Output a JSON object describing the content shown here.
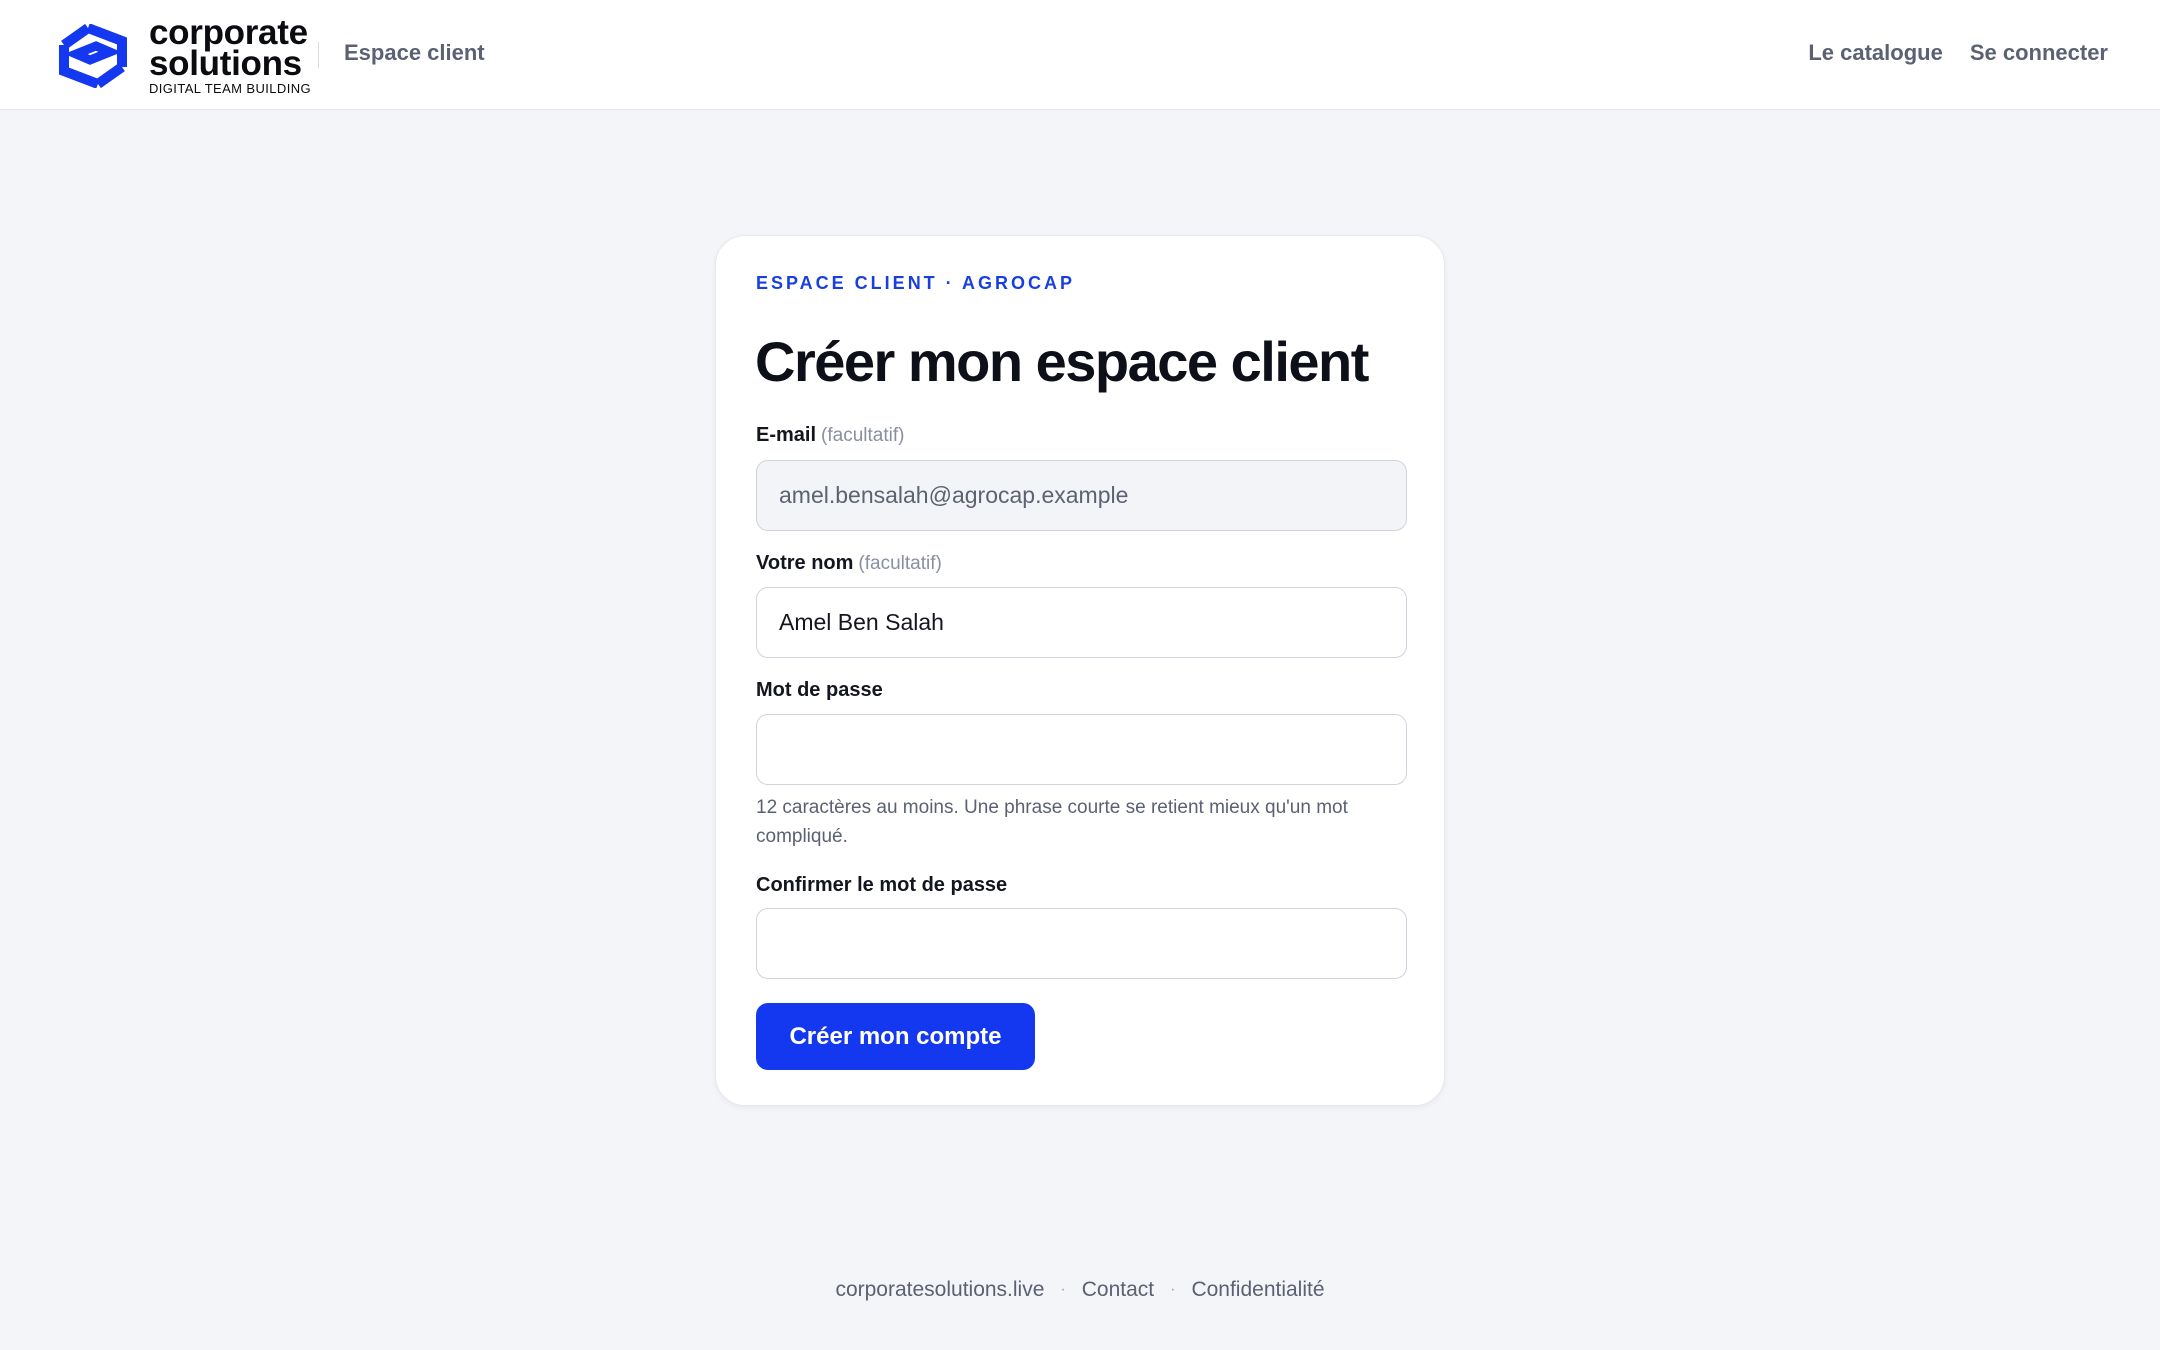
{
  "header": {
    "brand_name_line1": "corporate",
    "brand_name_line2": "solutions",
    "brand_tagline": "DIGITAL TEAM BUILDING",
    "section_link": "Espace client",
    "nav": {
      "catalogue": "Le catalogue",
      "login": "Se connecter"
    }
  },
  "card": {
    "eyebrow": "ESPACE CLIENT · AGROCAP",
    "title": "Créer mon espace client",
    "email": {
      "label": "E-mail",
      "optional": "(facultatif)",
      "value": "amel.bensalah@agrocap.example"
    },
    "name": {
      "label": "Votre nom",
      "optional": "(facultatif)",
      "value": "Amel Ben Salah"
    },
    "password": {
      "label": "Mot de passe",
      "value": "",
      "hint": "12 caractères au moins. Une phrase courte se retient mieux qu'un mot compliqué."
    },
    "confirm": {
      "label": "Confirmer le mot de passe",
      "value": ""
    },
    "submit_label": "Créer mon compte"
  },
  "footer": {
    "site": "corporatesolutions.live",
    "separator": "·",
    "contact": "Contact",
    "privacy": "Confidentialité"
  },
  "colors": {
    "accent": "#1438ef",
    "eyebrow": "#1a3fe0",
    "page_bg": "#f4f5f8",
    "muted_text": "#5b6173"
  },
  "icons": {
    "logo": "corporate-solutions-logo-icon"
  }
}
